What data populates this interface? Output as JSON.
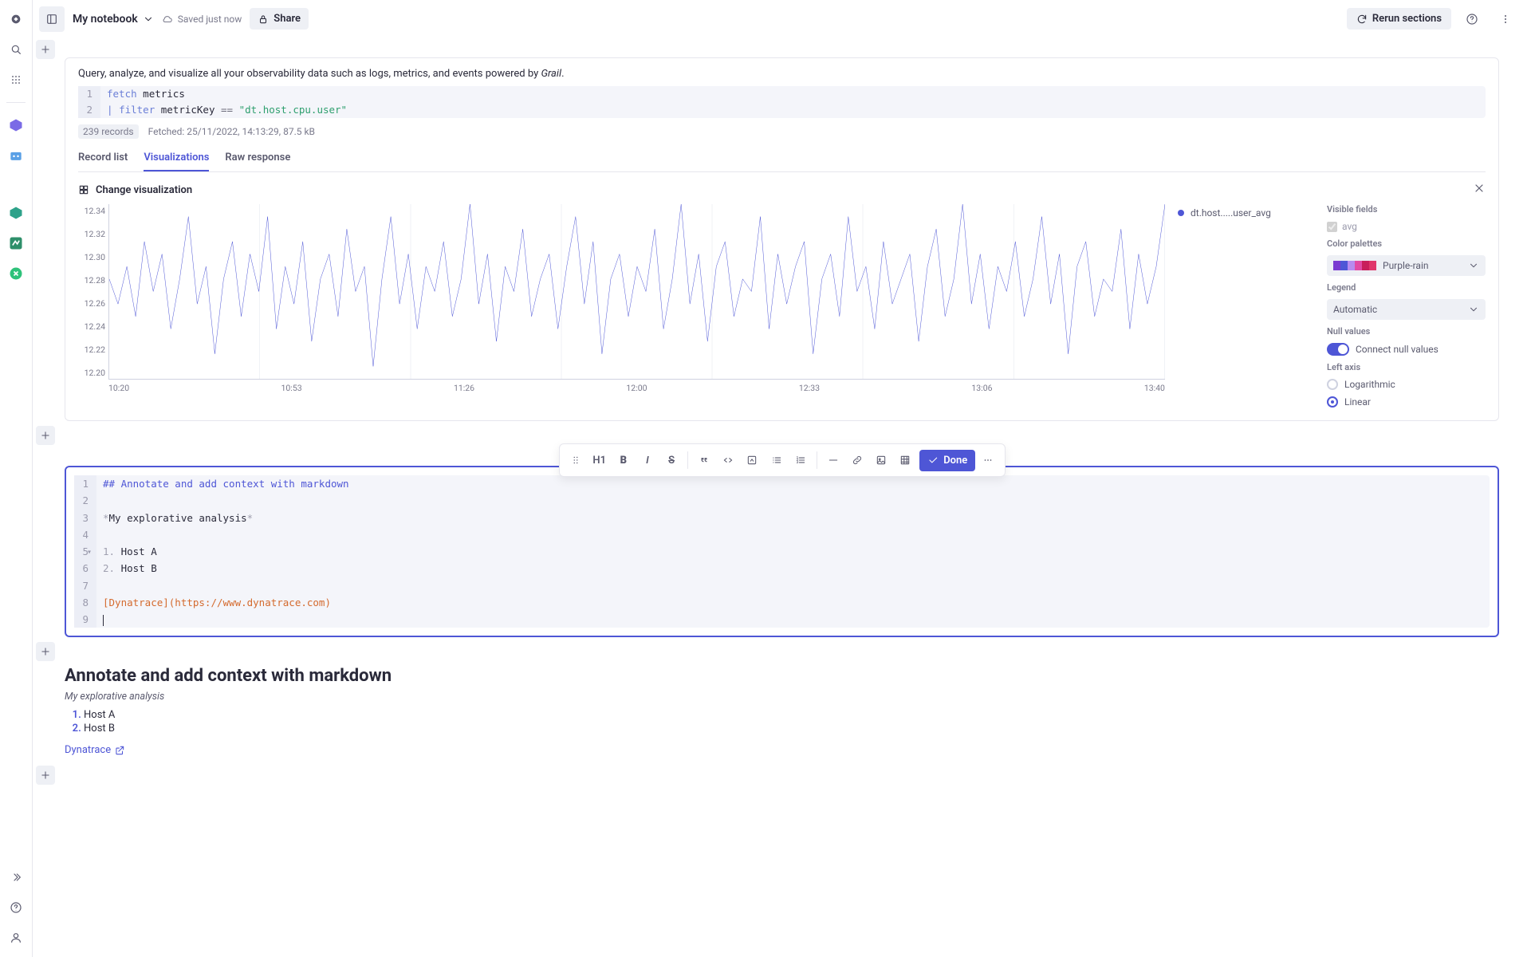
{
  "header": {
    "title": "My notebook",
    "saved": "Saved just now",
    "share": "Share",
    "rerun": "Rerun sections"
  },
  "section1": {
    "desc_prefix": "Query, analyze, and visualize all your observability data such as logs, metrics, and events powered by ",
    "desc_grail": "Grail",
    "desc_suffix": ".",
    "code": {
      "l1_kw": "fetch",
      "l1_rest": " metrics",
      "l2_pipe": "| ",
      "l2_kw": "filter",
      "l2_mid": " metricKey ",
      "l2_op": "==",
      "l2_sp": " ",
      "l2_str": "\"dt.host.cpu.user\""
    },
    "meta": {
      "records": "239 records",
      "fetched": "Fetched: 25/11/2022, 14:13:29, 87.5 kB"
    },
    "tabs": {
      "record": "Record list",
      "viz": "Visualizations",
      "raw": "Raw response"
    },
    "viz": {
      "change": "Change visualization",
      "legend_item": "dt.host.....user_avg",
      "y": [
        "12.34",
        "12.32",
        "12.30",
        "12.28",
        "12.26",
        "12.24",
        "12.22",
        "12.20"
      ],
      "x": [
        "10:20",
        "10:53",
        "11:26",
        "12:00",
        "12:33",
        "13:06",
        "13:40"
      ]
    },
    "side": {
      "visible_fields": "Visible fields",
      "avg": "avg",
      "color_palettes": "Color palettes",
      "palette_name": "Purple-rain",
      "legend": "Legend",
      "legend_value": "Automatic",
      "null_values": "Null values",
      "connect_null": "Connect null values",
      "left_axis": "Left axis",
      "log": "Logarithmic",
      "lin": "Linear"
    }
  },
  "toolbar": {
    "h1": "H1",
    "done": "Done"
  },
  "md": {
    "l1": "## Annotate and add context with markdown",
    "l3_a": "*",
    "l3_b": "My explorative analysis",
    "l3_c": "*",
    "l5_n": "1.",
    "l5_t": " Host A",
    "l6_n": "2.",
    "l6_t": " Host B",
    "l8": "[Dynatrace](https://www.dynatrace.com)"
  },
  "rendered": {
    "heading": "Annotate and add context with markdown",
    "sub": "My explorative analysis",
    "hostA": "Host A",
    "hostB": "Host B",
    "link": "Dynatrace"
  },
  "chart_data": {
    "type": "line",
    "title": "",
    "xlabel": "",
    "ylabel": "",
    "ylim": [
      12.2,
      12.34
    ],
    "x_ticks": [
      "10:20",
      "10:53",
      "11:26",
      "12:00",
      "12:33",
      "13:06",
      "13:40"
    ],
    "y_ticks": [
      12.2,
      12.22,
      12.24,
      12.26,
      12.28,
      12.3,
      12.32,
      12.34
    ],
    "series": [
      {
        "name": "dt.host.....user_avg",
        "color": "#4e56d6",
        "values": [
          12.28,
          12.26,
          12.29,
          12.25,
          12.31,
          12.27,
          12.3,
          12.24,
          12.28,
          12.33,
          12.26,
          12.29,
          12.22,
          12.28,
          12.31,
          12.25,
          12.3,
          12.27,
          12.33,
          12.24,
          12.29,
          12.26,
          12.31,
          12.23,
          12.28,
          12.3,
          12.25,
          12.32,
          12.27,
          12.29,
          12.21,
          12.28,
          12.33,
          12.26,
          12.3,
          12.24,
          12.29,
          12.27,
          12.31,
          12.25,
          12.28,
          12.34,
          12.26,
          12.3,
          12.23,
          12.29,
          12.27,
          12.32,
          12.25,
          12.28,
          12.3,
          12.24,
          12.29,
          12.33,
          12.26,
          12.31,
          12.22,
          12.28,
          12.3,
          12.25,
          12.29,
          12.27,
          12.32,
          12.24,
          12.28,
          12.34,
          12.26,
          12.3,
          12.23,
          12.29,
          12.31,
          12.25,
          12.28,
          12.27,
          12.33,
          12.24,
          12.3,
          12.26,
          12.29,
          12.31,
          12.22,
          12.28,
          12.3,
          12.25,
          12.33,
          12.27,
          12.29,
          12.24,
          12.31,
          12.26,
          12.28,
          12.3,
          12.23,
          12.29,
          12.32,
          12.25,
          12.28,
          12.34,
          12.26,
          12.3,
          12.24,
          12.29,
          12.27,
          12.31,
          12.25,
          12.28,
          12.33,
          12.26,
          12.3,
          12.22,
          12.29,
          12.31,
          12.25,
          12.28,
          12.27,
          12.32,
          12.24,
          12.3,
          12.26,
          12.29,
          12.34
        ]
      }
    ]
  },
  "palette": [
    "#7a3bd1",
    "#4e56d6",
    "#b78bf0",
    "#e24aa5",
    "#c81e5b",
    "#e0356a"
  ]
}
